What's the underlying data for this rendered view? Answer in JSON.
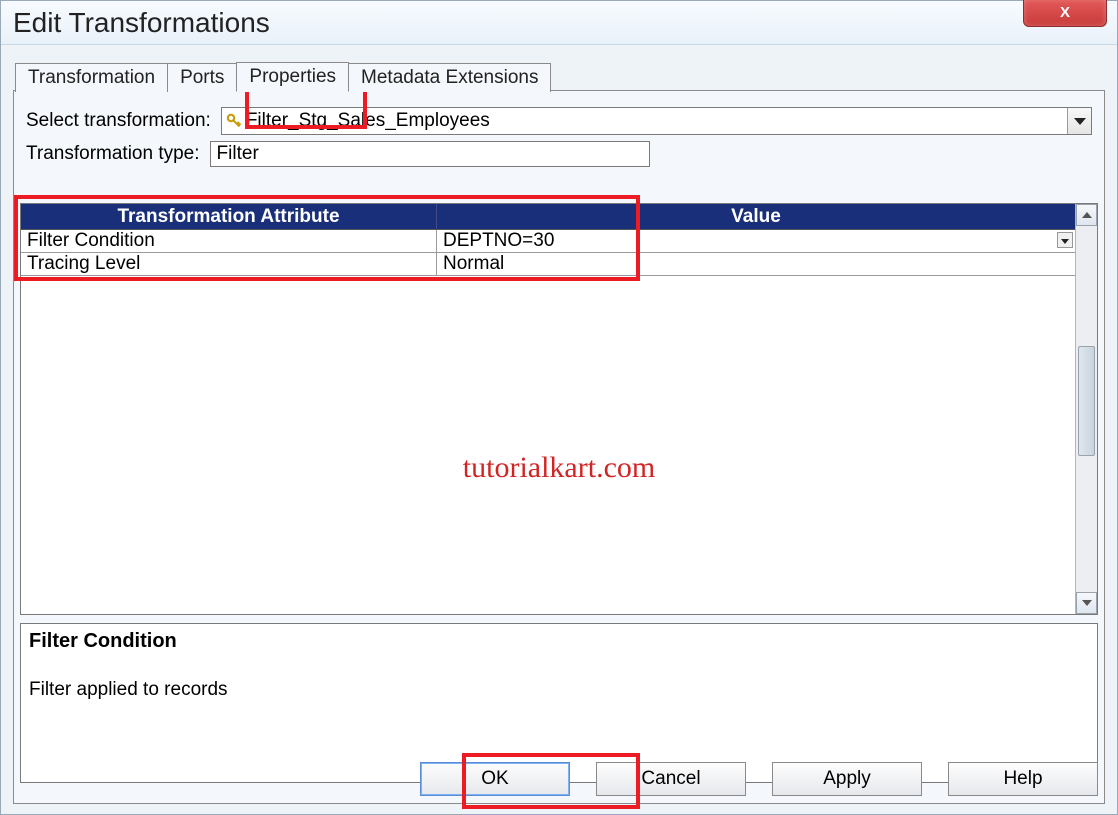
{
  "title": "Edit Transformations",
  "close_symbol": "X",
  "tabs": [
    {
      "label": "Transformation"
    },
    {
      "label": "Ports"
    },
    {
      "label": "Properties"
    },
    {
      "label": "Metadata Extensions"
    }
  ],
  "active_tab_index": 2,
  "form": {
    "select_label": "Select transformation:",
    "select_value": "Filter_Stg_Sales_Employees",
    "type_label": "Transformation type:",
    "type_value": "Filter"
  },
  "grid": {
    "headers": {
      "attr": "Transformation Attribute",
      "val": "Value"
    },
    "rows": [
      {
        "attr": "Filter Condition",
        "val": "DEPTNO=30",
        "editable": true
      },
      {
        "attr": "Tracing Level",
        "val": "Normal",
        "editable": false
      }
    ]
  },
  "description": {
    "title": "Filter Condition",
    "body": "Filter applied to records"
  },
  "buttons": {
    "ok": "OK",
    "cancel": "Cancel",
    "apply": "Apply",
    "help": "Help"
  },
  "watermark": "tutorialkart.com"
}
